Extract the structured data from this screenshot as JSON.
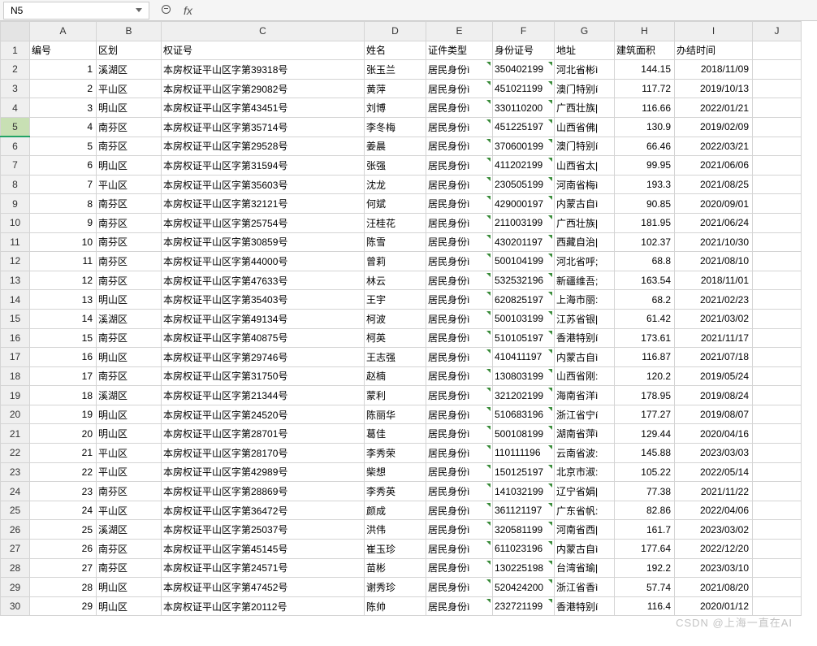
{
  "name_box": "N5",
  "fx_label": "fx",
  "columns": [
    "A",
    "B",
    "C",
    "D",
    "E",
    "F",
    "G",
    "H",
    "I",
    "J"
  ],
  "headers": [
    "编号",
    "区划",
    "权证号",
    "姓名",
    "证件类型",
    "身份证号",
    "地址",
    "建筑面积",
    "办结时间"
  ],
  "selected_row": 5,
  "rows": [
    {
      "n": 1,
      "a": "1",
      "b": "溪湖区",
      "c": "本房权证平山区字第39318号",
      "d": "张玉兰",
      "e": "居民身份ì",
      "f": "350402199",
      "g": "河北省彬ì",
      "h": "144.15",
      "i": "2018/11/09"
    },
    {
      "n": 2,
      "a": "2",
      "b": "平山区",
      "c": "本房权证平山区字第29082号",
      "d": "黄萍",
      "e": "居民身份ì",
      "f": "451021199",
      "g": "澳门特别í",
      "h": "117.72",
      "i": "2019/10/13"
    },
    {
      "n": 3,
      "a": "3",
      "b": "明山区",
      "c": "本房权证平山区字第43451号",
      "d": "刘博",
      "e": "居民身份ì",
      "f": "330110200",
      "g": "广西壮族|",
      "h": "116.66",
      "i": "2022/01/21"
    },
    {
      "n": 4,
      "a": "4",
      "b": "南芬区",
      "c": "本房权证平山区字第35714号",
      "d": "李冬梅",
      "e": "居民身份ì",
      "f": "451225197",
      "g": "山西省佛|",
      "h": "130.9",
      "i": "2019/02/09"
    },
    {
      "n": 5,
      "a": "5",
      "b": "南芬区",
      "c": "本房权证平山区字第29528号",
      "d": "姜晨",
      "e": "居民身份ì",
      "f": "370600199",
      "g": "澳门特别í",
      "h": "66.46",
      "i": "2022/03/21"
    },
    {
      "n": 6,
      "a": "6",
      "b": "明山区",
      "c": "本房权证平山区字第31594号",
      "d": "张强",
      "e": "居民身份ì",
      "f": "411202199",
      "g": "山西省太|",
      "h": "99.95",
      "i": "2021/06/06"
    },
    {
      "n": 7,
      "a": "7",
      "b": "平山区",
      "c": "本房权证平山区字第35603号",
      "d": "沈龙",
      "e": "居民身份ì",
      "f": "230505199",
      "g": "河南省梅ì",
      "h": "193.3",
      "i": "2021/08/25"
    },
    {
      "n": 8,
      "a": "8",
      "b": "南芬区",
      "c": "本房权证平山区字第32121号",
      "d": "何斌",
      "e": "居民身份ì",
      "f": "429000197",
      "g": "内蒙古自ì",
      "h": "90.85",
      "i": "2020/09/01"
    },
    {
      "n": 9,
      "a": "9",
      "b": "南芬区",
      "c": "本房权证平山区字第25754号",
      "d": "汪桂花",
      "e": "居民身份ì",
      "f": "211003199",
      "g": "广西壮族|",
      "h": "181.95",
      "i": "2021/06/24"
    },
    {
      "n": 10,
      "a": "10",
      "b": "南芬区",
      "c": "本房权证平山区字第30859号",
      "d": "陈雪",
      "e": "居民身份ì",
      "f": "430201197",
      "g": "西藏自治|",
      "h": "102.37",
      "i": "2021/10/30"
    },
    {
      "n": 11,
      "a": "11",
      "b": "南芬区",
      "c": "本房权证平山区字第44000号",
      "d": "曾莉",
      "e": "居民身份ì",
      "f": "500104199",
      "g": "河北省呼;",
      "h": "68.8",
      "i": "2021/08/10"
    },
    {
      "n": 12,
      "a": "12",
      "b": "南芬区",
      "c": "本房权证平山区字第47633号",
      "d": "林云",
      "e": "居民身份ì",
      "f": "532532196",
      "g": "新疆维吾;",
      "h": "163.54",
      "i": "2018/11/01"
    },
    {
      "n": 13,
      "a": "13",
      "b": "明山区",
      "c": "本房权证平山区字第35403号",
      "d": "王宇",
      "e": "居民身份ì",
      "f": "620825197",
      "g": "上海市丽:",
      "h": "68.2",
      "i": "2021/02/23"
    },
    {
      "n": 14,
      "a": "14",
      "b": "溪湖区",
      "c": "本房权证平山区字第49134号",
      "d": "柯波",
      "e": "居民身份ì",
      "f": "500103199",
      "g": "江苏省银|",
      "h": "61.42",
      "i": "2021/03/02"
    },
    {
      "n": 15,
      "a": "15",
      "b": "南芬区",
      "c": "本房权证平山区字第40875号",
      "d": "柯英",
      "e": "居民身份ì",
      "f": "510105197",
      "g": "香港特别í",
      "h": "173.61",
      "i": "2021/11/17"
    },
    {
      "n": 16,
      "a": "16",
      "b": "明山区",
      "c": "本房权证平山区字第29746号",
      "d": "王志强",
      "e": "居民身份ì",
      "f": "410411197",
      "g": "内蒙古自ì",
      "h": "116.87",
      "i": "2021/07/18"
    },
    {
      "n": 17,
      "a": "17",
      "b": "南芬区",
      "c": "本房权证平山区字第31750号",
      "d": "赵楠",
      "e": "居民身份ì",
      "f": "130803199",
      "g": "山西省刚:",
      "h": "120.2",
      "i": "2019/05/24"
    },
    {
      "n": 18,
      "a": "18",
      "b": "溪湖区",
      "c": "本房权证平山区字第21344号",
      "d": "蒙利",
      "e": "居民身份ì",
      "f": "321202199",
      "g": "海南省洋ì",
      "h": "178.95",
      "i": "2019/08/24"
    },
    {
      "n": 19,
      "a": "19",
      "b": "明山区",
      "c": "本房权证平山区字第24520号",
      "d": "陈丽华",
      "e": "居民身份ì",
      "f": "510683196",
      "g": "浙江省宁í",
      "h": "177.27",
      "i": "2019/08/07"
    },
    {
      "n": 20,
      "a": "20",
      "b": "明山区",
      "c": "本房权证平山区字第28701号",
      "d": "葛佳",
      "e": "居民身份ì",
      "f": "500108199",
      "g": "湖南省萍ì",
      "h": "129.44",
      "i": "2020/04/16"
    },
    {
      "n": 21,
      "a": "21",
      "b": "平山区",
      "c": "本房权证平山区字第28170号",
      "d": "李秀荣",
      "e": "居民身份ì",
      "f": "110111196",
      "g": "云南省波:",
      "h": "145.88",
      "i": "2023/03/03"
    },
    {
      "n": 22,
      "a": "22",
      "b": "平山区",
      "c": "本房权证平山区字第42989号",
      "d": "柴想",
      "e": "居民身份ì",
      "f": "150125197",
      "g": "北京市淑:",
      "h": "105.22",
      "i": "2022/05/14"
    },
    {
      "n": 23,
      "a": "23",
      "b": "南芬区",
      "c": "本房权证平山区字第28869号",
      "d": "李秀英",
      "e": "居民身份ì",
      "f": "141032199",
      "g": "辽宁省娟|",
      "h": "77.38",
      "i": "2021/11/22"
    },
    {
      "n": 24,
      "a": "24",
      "b": "平山区",
      "c": "本房权证平山区字第36472号",
      "d": "颜成",
      "e": "居民身份ì",
      "f": "361121197",
      "g": "广东省帆:",
      "h": "82.86",
      "i": "2022/04/06"
    },
    {
      "n": 25,
      "a": "25",
      "b": "溪湖区",
      "c": "本房权证平山区字第25037号",
      "d": "洪伟",
      "e": "居民身份ì",
      "f": "320581199",
      "g": "河南省西|",
      "h": "161.7",
      "i": "2023/03/02"
    },
    {
      "n": 26,
      "a": "26",
      "b": "南芬区",
      "c": "本房权证平山区字第45145号",
      "d": "崔玉珍",
      "e": "居民身份ì",
      "f": "611023196",
      "g": "内蒙古自ì",
      "h": "177.64",
      "i": "2022/12/20"
    },
    {
      "n": 27,
      "a": "27",
      "b": "南芬区",
      "c": "本房权证平山区字第24571号",
      "d": "苗彬",
      "e": "居民身份ì",
      "f": "130225198",
      "g": "台湾省瑜|",
      "h": "192.2",
      "i": "2023/03/10"
    },
    {
      "n": 28,
      "a": "28",
      "b": "明山区",
      "c": "本房权证平山区字第47452号",
      "d": "谢秀珍",
      "e": "居民身份ì",
      "f": "520424200",
      "g": "浙江省香ì",
      "h": "57.74",
      "i": "2021/08/20"
    },
    {
      "n": 29,
      "a": "29",
      "b": "明山区",
      "c": "本房权证平山区字第20112号",
      "d": "陈帅",
      "e": "居民身份ì",
      "f": "232721199",
      "g": "香港特别í",
      "h": "116.4",
      "i": "2020/01/12"
    }
  ],
  "watermark": "CSDN @上海一直在AI"
}
